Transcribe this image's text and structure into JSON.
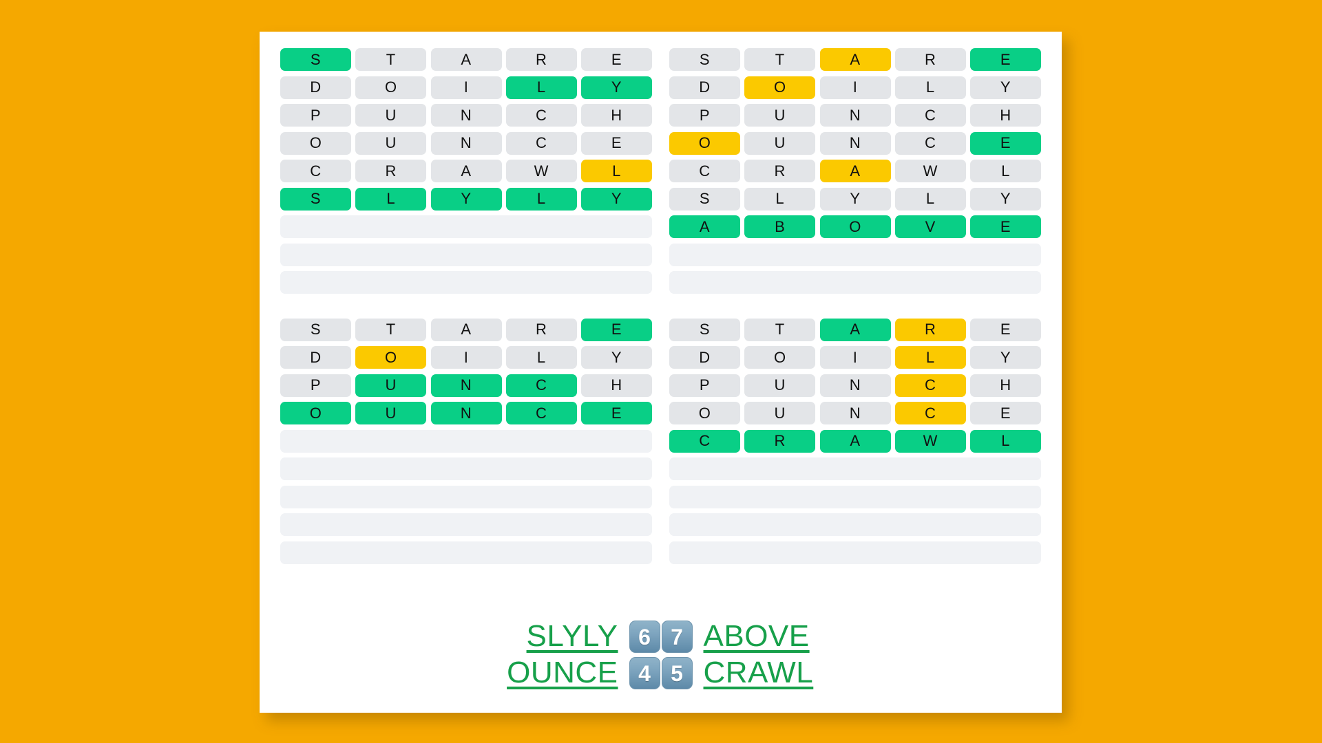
{
  "app": {
    "name": "Quordle daily results board",
    "background_color": "#f5a800",
    "card_color": "#ffffff"
  },
  "colors": {
    "green": "#09cf86",
    "yellow": "#fbc900",
    "gray": "#e3e5e8",
    "empty_row": "#f0f2f5",
    "word_link": "#17a04a",
    "number_tile": "#7ea5bf"
  },
  "boards": [
    {
      "id": "board-top-left",
      "position": "top-left",
      "answer": "SLYLY",
      "guess_count": 6,
      "max_rows": 9,
      "rows": [
        {
          "letters": [
            "S",
            "T",
            "A",
            "R",
            "E"
          ],
          "states": [
            "green",
            "gray",
            "gray",
            "gray",
            "gray"
          ]
        },
        {
          "letters": [
            "D",
            "O",
            "I",
            "L",
            "Y"
          ],
          "states": [
            "gray",
            "gray",
            "gray",
            "green",
            "green"
          ]
        },
        {
          "letters": [
            "P",
            "U",
            "N",
            "C",
            "H"
          ],
          "states": [
            "gray",
            "gray",
            "gray",
            "gray",
            "gray"
          ]
        },
        {
          "letters": [
            "O",
            "U",
            "N",
            "C",
            "E"
          ],
          "states": [
            "gray",
            "gray",
            "gray",
            "gray",
            "gray"
          ]
        },
        {
          "letters": [
            "C",
            "R",
            "A",
            "W",
            "L"
          ],
          "states": [
            "gray",
            "gray",
            "gray",
            "gray",
            "yellow"
          ]
        },
        {
          "letters": [
            "S",
            "L",
            "Y",
            "L",
            "Y"
          ],
          "states": [
            "green",
            "green",
            "green",
            "green",
            "green"
          ]
        },
        {
          "letters": [],
          "states": []
        },
        {
          "letters": [],
          "states": []
        },
        {
          "letters": [],
          "states": []
        }
      ]
    },
    {
      "id": "board-top-right",
      "position": "top-right",
      "answer": "ABOVE",
      "guess_count": 7,
      "max_rows": 9,
      "rows": [
        {
          "letters": [
            "S",
            "T",
            "A",
            "R",
            "E"
          ],
          "states": [
            "gray",
            "gray",
            "yellow",
            "gray",
            "green"
          ]
        },
        {
          "letters": [
            "D",
            "O",
            "I",
            "L",
            "Y"
          ],
          "states": [
            "gray",
            "yellow",
            "gray",
            "gray",
            "gray"
          ]
        },
        {
          "letters": [
            "P",
            "U",
            "N",
            "C",
            "H"
          ],
          "states": [
            "gray",
            "gray",
            "gray",
            "gray",
            "gray"
          ]
        },
        {
          "letters": [
            "O",
            "U",
            "N",
            "C",
            "E"
          ],
          "states": [
            "yellow",
            "gray",
            "gray",
            "gray",
            "green"
          ]
        },
        {
          "letters": [
            "C",
            "R",
            "A",
            "W",
            "L"
          ],
          "states": [
            "gray",
            "gray",
            "yellow",
            "gray",
            "gray"
          ]
        },
        {
          "letters": [
            "S",
            "L",
            "Y",
            "L",
            "Y"
          ],
          "states": [
            "gray",
            "gray",
            "gray",
            "gray",
            "gray"
          ]
        },
        {
          "letters": [
            "A",
            "B",
            "O",
            "V",
            "E"
          ],
          "states": [
            "green",
            "green",
            "green",
            "green",
            "green"
          ]
        },
        {
          "letters": [],
          "states": []
        },
        {
          "letters": [],
          "states": []
        }
      ]
    },
    {
      "id": "board-bottom-left",
      "position": "bottom-left",
      "answer": "OUNCE",
      "guess_count": 4,
      "max_rows": 9,
      "rows": [
        {
          "letters": [
            "S",
            "T",
            "A",
            "R",
            "E"
          ],
          "states": [
            "gray",
            "gray",
            "gray",
            "gray",
            "green"
          ]
        },
        {
          "letters": [
            "D",
            "O",
            "I",
            "L",
            "Y"
          ],
          "states": [
            "gray",
            "yellow",
            "gray",
            "gray",
            "gray"
          ]
        },
        {
          "letters": [
            "P",
            "U",
            "N",
            "C",
            "H"
          ],
          "states": [
            "gray",
            "green",
            "green",
            "green",
            "gray"
          ]
        },
        {
          "letters": [
            "O",
            "U",
            "N",
            "C",
            "E"
          ],
          "states": [
            "green",
            "green",
            "green",
            "green",
            "green"
          ]
        },
        {
          "letters": [],
          "states": []
        },
        {
          "letters": [],
          "states": []
        },
        {
          "letters": [],
          "states": []
        },
        {
          "letters": [],
          "states": []
        },
        {
          "letters": [],
          "states": []
        }
      ]
    },
    {
      "id": "board-bottom-right",
      "position": "bottom-right",
      "answer": "CRAWL",
      "guess_count": 5,
      "max_rows": 9,
      "rows": [
        {
          "letters": [
            "S",
            "T",
            "A",
            "R",
            "E"
          ],
          "states": [
            "gray",
            "gray",
            "green",
            "yellow",
            "gray"
          ]
        },
        {
          "letters": [
            "D",
            "O",
            "I",
            "L",
            "Y"
          ],
          "states": [
            "gray",
            "gray",
            "gray",
            "yellow",
            "gray"
          ]
        },
        {
          "letters": [
            "P",
            "U",
            "N",
            "C",
            "H"
          ],
          "states": [
            "gray",
            "gray",
            "gray",
            "yellow",
            "gray"
          ]
        },
        {
          "letters": [
            "O",
            "U",
            "N",
            "C",
            "E"
          ],
          "states": [
            "gray",
            "gray",
            "gray",
            "yellow",
            "gray"
          ]
        },
        {
          "letters": [
            "C",
            "R",
            "A",
            "W",
            "L"
          ],
          "states": [
            "green",
            "green",
            "green",
            "green",
            "green"
          ]
        },
        {
          "letters": [],
          "states": []
        },
        {
          "letters": [],
          "states": []
        },
        {
          "letters": [],
          "states": []
        },
        {
          "letters": [],
          "states": []
        }
      ]
    }
  ],
  "footer": {
    "lines": [
      {
        "left_word": "SLYLY",
        "left_score": "6",
        "right_score": "7",
        "right_word": "ABOVE"
      },
      {
        "left_word": "OUNCE",
        "left_score": "4",
        "right_score": "5",
        "right_word": "CRAWL"
      }
    ]
  }
}
